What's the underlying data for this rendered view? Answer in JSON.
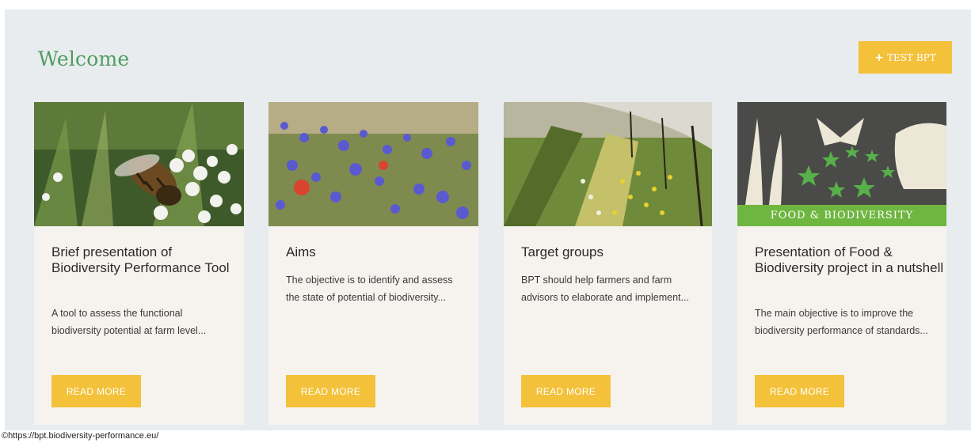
{
  "header": {
    "title": "Welcome",
    "test_button": {
      "icon": "plus-icon",
      "label": "TEST BPT"
    }
  },
  "cards": [
    {
      "image": "bee-on-flowers-image",
      "title": "Brief presentation of Biodiversity Performance Tool",
      "text": "A tool to assess the functional biodiversity potential at farm level...",
      "button": "READ MORE"
    },
    {
      "image": "wildflower-meadow-image",
      "title": "Aims",
      "text": "The objective is to identify and assess the state of potential of biodiversity...",
      "button": "READ MORE"
    },
    {
      "image": "field-margin-image",
      "title": "Target groups",
      "text": "BPT should help farmers and farm advisors to elaborate and implement...",
      "button": "READ MORE"
    },
    {
      "image": "food-biodiversity-logo-image",
      "logo_text": "FOOD & BIODIVERSITY",
      "title": "Presentation of Food & Biodiversity project in a nutshell",
      "text": "The main objective is to improve the biodiversity performance of standards...",
      "button": "READ MORE"
    }
  ],
  "footer": {
    "credit": "©https://bpt.biodiversity-performance.eu/"
  },
  "colors": {
    "accent": "#f3c13a",
    "title_green": "#4f9c61",
    "panel_bg": "#e8ecef",
    "card_bg": "#f6f3ef"
  }
}
